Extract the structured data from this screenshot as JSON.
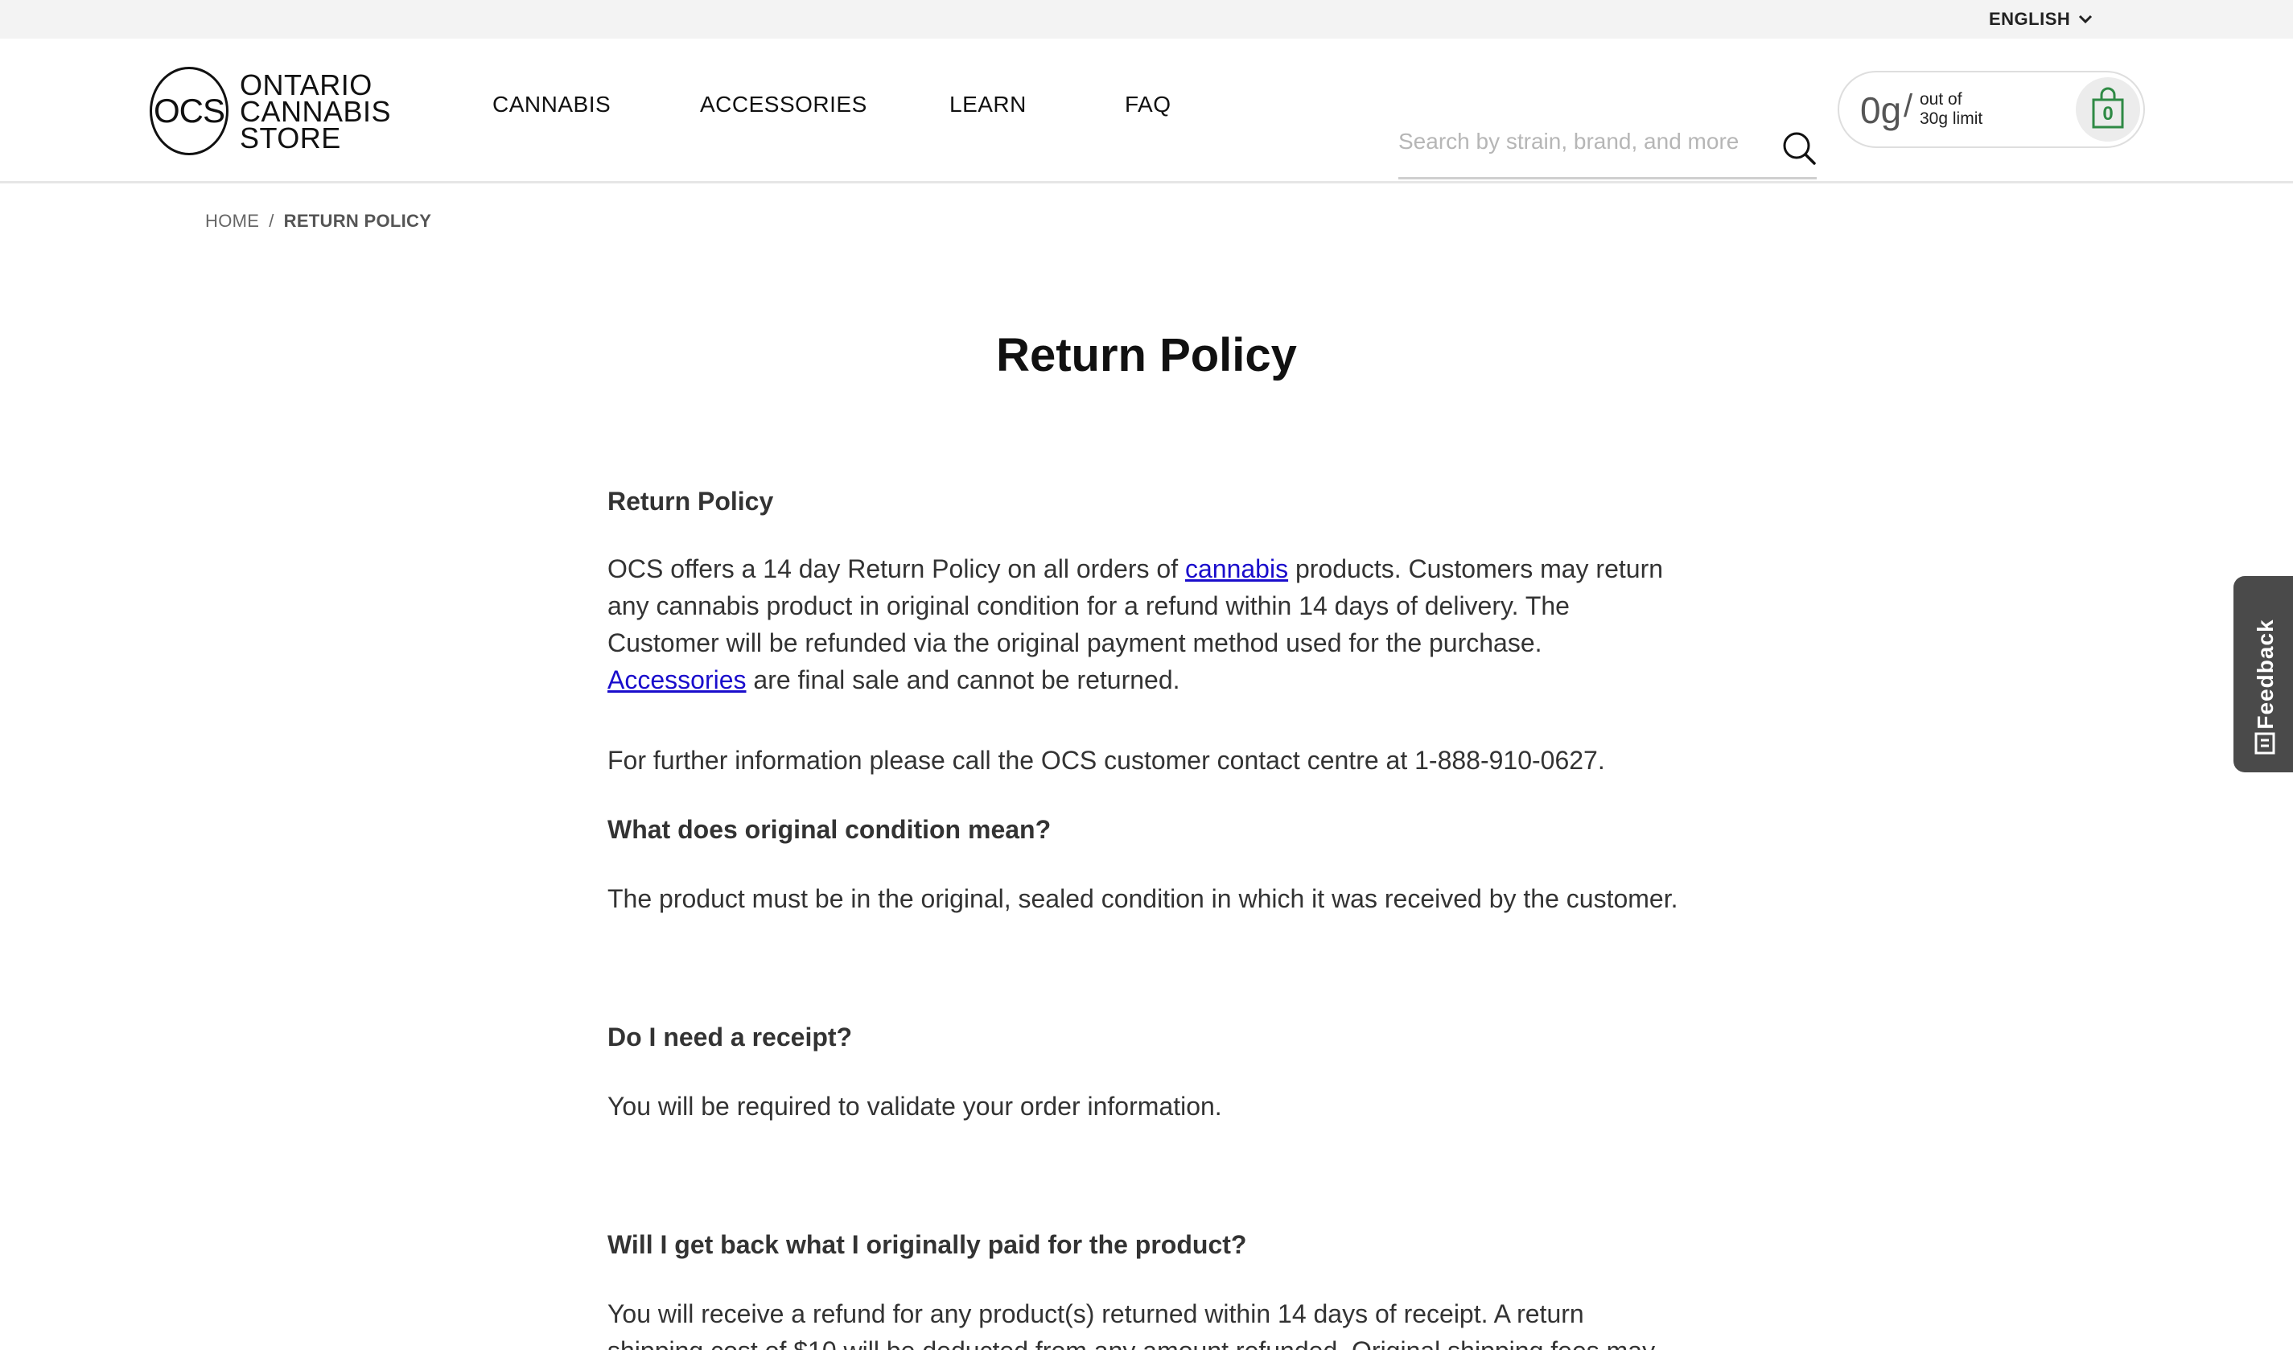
{
  "topbar": {
    "language": "ENGLISH"
  },
  "header": {
    "logo": {
      "mark": "OCS",
      "line1": "ONTARIO",
      "line2": "CANNABIS",
      "line3": "STORE"
    },
    "nav": [
      {
        "label": "CANNABIS"
      },
      {
        "label": "ACCESSORIES"
      },
      {
        "label": "LEARN"
      },
      {
        "label": "FAQ"
      }
    ],
    "search": {
      "placeholder": "Search by strain, brand, and more",
      "value": ""
    },
    "limit": {
      "amount": "0g",
      "slash": "/",
      "line1": "out of",
      "line2": "30g limit"
    },
    "cart": {
      "count": "0"
    },
    "colors": {
      "accent": "#2f8a45",
      "link": "#1a0dcc",
      "feedback_bg": "#4a4a4a"
    }
  },
  "breadcrumb": {
    "home": "HOME",
    "separator": "/",
    "current": "RETURN POLICY"
  },
  "page": {
    "title": "Return Policy",
    "h1": "Return Policy",
    "p1_a": "OCS offers a 14 day Return Policy on all orders of ",
    "p1_link1": "cannabis",
    "p1_b": " products. Customers may return any cannabis product in original condition for a refund within 14 days of delivery. The Customer will be refunded via the original payment method used for the purchase. ",
    "p1_link2": "Accessories",
    "p1_c": " are final sale and cannot be returned.",
    "p2": "For further information please call the OCS customer contact centre at 1-888-910-0627.",
    "h2": "What does original condition mean?",
    "p3": "The product must be in the original, sealed condition in which it was received by the customer.",
    "h3": "Do I need a receipt?",
    "p4": "You will be required to validate your order information.",
    "h4": "Will I get back what I originally paid for the product?",
    "p5": "You will receive a refund for any product(s) returned within 14 days of receipt. A return shipping cost of $10 will be deducted from any amount refunded. Original shipping fees may be refunded"
  },
  "feedback": {
    "label": "Feedback",
    "icon": "feedback-icon"
  }
}
